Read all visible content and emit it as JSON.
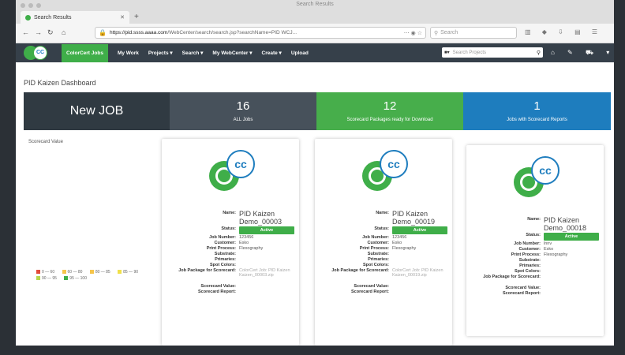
{
  "browser": {
    "window_title": "Search Results",
    "tab_title": "Search Results",
    "url_host": "https://pid.ssss.aaaa.com",
    "url_path": "/WebCenter/search/search.jsp?searchName=PID WCJ...",
    "search_placeholder": "Search"
  },
  "app": {
    "logo_text": "CC",
    "menu": [
      {
        "label": "ColorCert Jobs"
      },
      {
        "label": "My Work"
      },
      {
        "label": "Projects ▾"
      },
      {
        "label": "Search ▾"
      },
      {
        "label": "My WebCenter ▾"
      },
      {
        "label": "Create ▾"
      },
      {
        "label": "Upload"
      }
    ],
    "search_scope": "▾",
    "search_placeholder": "Search Projects"
  },
  "page": {
    "title": "PID Kaizen Dashboard",
    "banner": {
      "new_job": "New JOB",
      "tiles": [
        {
          "num": "16",
          "label": "ALL Jobs"
        },
        {
          "num": "12",
          "label": "Scorecard Packages ready for Download"
        },
        {
          "num": "1",
          "label": "Jobs with Scorecard Reports"
        }
      ]
    },
    "scorecard_label": "Scorecard Value",
    "legend": [
      {
        "label": "0 — 60",
        "color": "#e24b3b"
      },
      {
        "label": "60 — 80",
        "color": "#f6c54a"
      },
      {
        "label": "80 — 85",
        "color": "#f6c54a"
      },
      {
        "label": "85 — 90",
        "color": "#f0e04a"
      },
      {
        "label": "90 — 95",
        "color": "#b7d84b"
      },
      {
        "label": "95 — 100",
        "color": "#3fae49"
      }
    ]
  },
  "card_labels": {
    "name": "Name:",
    "status": "Status:",
    "job_number": "Job Number:",
    "customer": "Customer:",
    "print_process": "Print Process:",
    "substrate": "Substrate:",
    "primaries": "Primaries:",
    "spot_colors": "Spot Colors:",
    "job_package": "Job Package for Scorecard:",
    "scorecard_value": "Scorecard Value:",
    "scorecard_report": "Scorecard Report:"
  },
  "cards": [
    {
      "name": "PID Kaizen Demo_00003",
      "status": "Active",
      "job_number": "123456",
      "customer": "Esko",
      "print_process": "Flexography",
      "job_package": "ColorCert Job: PID Kaizen",
      "job_package_sub": "Kaizen_00003.zip"
    },
    {
      "name": "PID Kaizen Demo_00019",
      "status": "Active",
      "job_number": "123456",
      "customer": "Esko",
      "print_process": "Flexography",
      "job_package": "ColorCert Job: PID Kaizen",
      "job_package_sub": "Kaizen_00019.zip"
    },
    {
      "name": "PID Kaizen Demo_00018",
      "status": "Active",
      "job_number": "lnnv",
      "customer": "Esko",
      "print_process": "Flexography",
      "job_package": "",
      "job_package_sub": ""
    }
  ]
}
